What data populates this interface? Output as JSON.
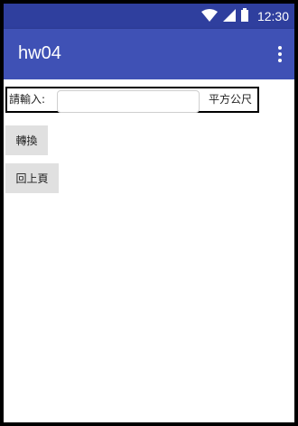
{
  "status_bar": {
    "time": "12:30",
    "icons": [
      "wifi-icon",
      "cell-signal-icon",
      "battery-icon"
    ],
    "background": "#2f3f9e"
  },
  "app_bar": {
    "title": "hw04",
    "overflow_icon": "more-vert-icon",
    "background": "#3f51b5"
  },
  "form": {
    "input_label": "請輸入:",
    "input_value": "",
    "input_placeholder": "",
    "unit_label": "平方公尺"
  },
  "buttons": {
    "convert_label": "轉換",
    "back_label": "回上頁"
  }
}
